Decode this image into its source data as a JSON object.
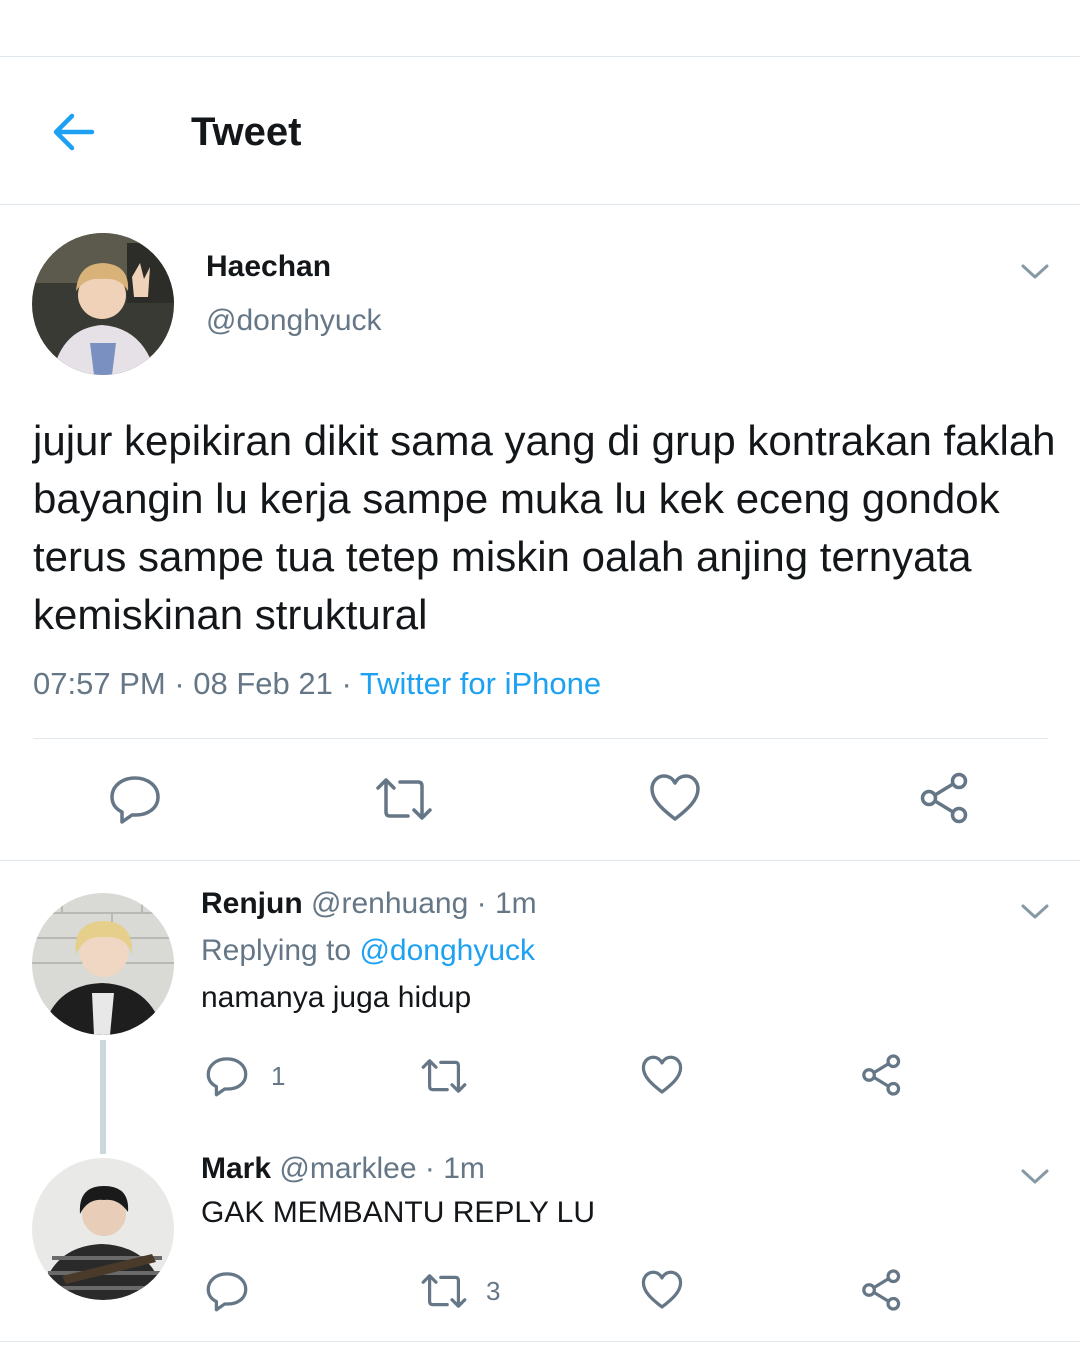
{
  "header": {
    "title": "Tweet",
    "back_icon": "arrow-left-icon",
    "accent": "#1da1f2"
  },
  "main_tweet": {
    "display_name": "Haechan",
    "handle": "@donghyuck",
    "text": "jujur kepikiran dikit sama yang di grup kontrakan faklah bayangin lu kerja sampe muka lu kek eceng gondok terus sampe tua tetep miskin oalah anjing ternyata kemiskinan struktural",
    "time": "07:57 PM",
    "date": "08 Feb 21",
    "source": "Twitter for iPhone",
    "actions": [
      "reply-icon",
      "retweet-icon",
      "like-icon",
      "share-icon"
    ]
  },
  "replies": [
    {
      "display_name": "Renjun",
      "handle": "@renhuang",
      "age": "1m",
      "replying_label": "Replying to",
      "replying_to": "@donghyuck",
      "text": "namanya juga hidup",
      "reply_count": "1",
      "retweet_count": "",
      "like_count": ""
    },
    {
      "display_name": "Mark",
      "handle": "@marklee",
      "age": "1m",
      "text": "GAK MEMBANTU REPLY LU",
      "reply_count": "",
      "retweet_count": "3",
      "like_count": ""
    }
  ],
  "separator_dot": "·"
}
